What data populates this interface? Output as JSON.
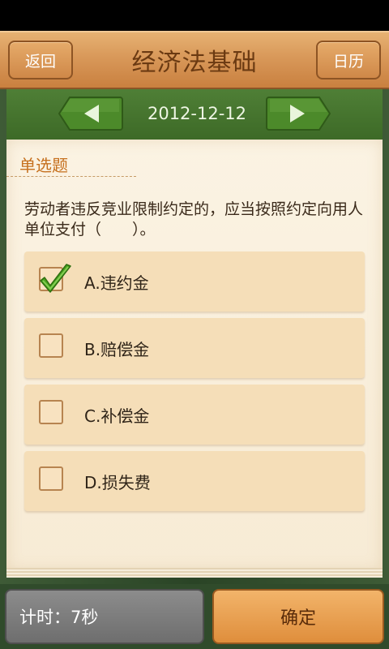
{
  "header": {
    "back_label": "返回",
    "title": "经济法基础",
    "calendar_label": "日历"
  },
  "date_nav": {
    "date": "2012-12-12"
  },
  "section": {
    "label": "单选题"
  },
  "question": {
    "text": "劳动者违反竞业限制约定的，应当按照约定向用人单位支付（　　）。"
  },
  "options": [
    {
      "label": "A.违约金",
      "checked": true
    },
    {
      "label": "B.赔偿金",
      "checked": false
    },
    {
      "label": "C.补偿金",
      "checked": false
    },
    {
      "label": "D.损失费",
      "checked": false
    }
  ],
  "footer": {
    "timer_label": "计时：7秒",
    "confirm_label": "确定"
  },
  "colors": {
    "header_wood": "#d9995a",
    "board_green": "#3d6a27",
    "paper": "#fbf3e3",
    "accent_orange": "#c6701e",
    "check_green": "#4aa31f"
  },
  "icons": {
    "prev": "left-arrow-icon",
    "next": "right-arrow-icon",
    "check": "check-mark-icon"
  }
}
